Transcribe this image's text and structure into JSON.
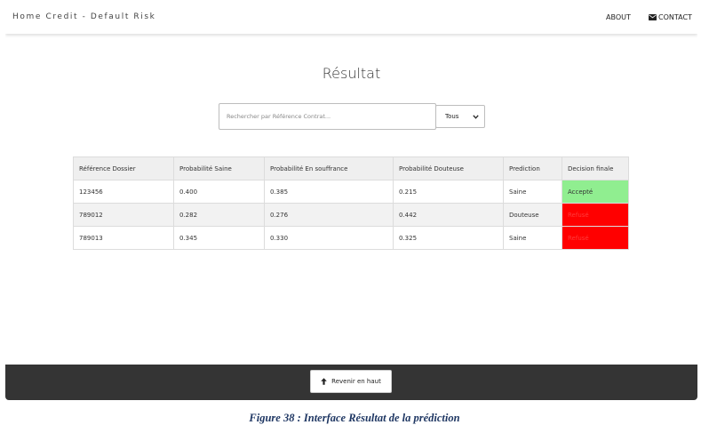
{
  "navbar": {
    "brand": "Home Credit - Default Risk",
    "about": "ABOUT",
    "contact": "CONTACT",
    "contact_icon": "envelope-icon"
  },
  "main": {
    "title": "Résultat",
    "search_placeholder": "Rechercher par Référence Contrat...",
    "filter_selected": "Tous",
    "filter_icon": "chevron-down-icon"
  },
  "table": {
    "headers": [
      "Référence Dossier",
      "Probabilité Saine",
      "Probabilité En souffrance",
      "Probabilité Douteuse",
      "Prediction",
      "Decision finale"
    ],
    "rows": [
      {
        "ref": "123456",
        "saine": "0.400",
        "souffrance": "0.385",
        "douteuse": "0.215",
        "prediction": "Saine",
        "decision": "Accepté",
        "decision_color": "#90ee90"
      },
      {
        "ref": "789012",
        "saine": "0.282",
        "souffrance": "0.276",
        "douteuse": "0.442",
        "prediction": "Douteuse",
        "decision": "Refusé",
        "decision_color": "#ff0000"
      },
      {
        "ref": "789013",
        "saine": "0.345",
        "souffrance": "0.330",
        "douteuse": "0.325",
        "prediction": "Saine",
        "decision": "Refusé",
        "decision_color": "#ff0000"
      }
    ]
  },
  "footer": {
    "back_to_top": "Revenir en haut",
    "back_icon": "arrow-up-icon"
  },
  "caption": "Figure 38 : Interface Résultat de la prédiction"
}
